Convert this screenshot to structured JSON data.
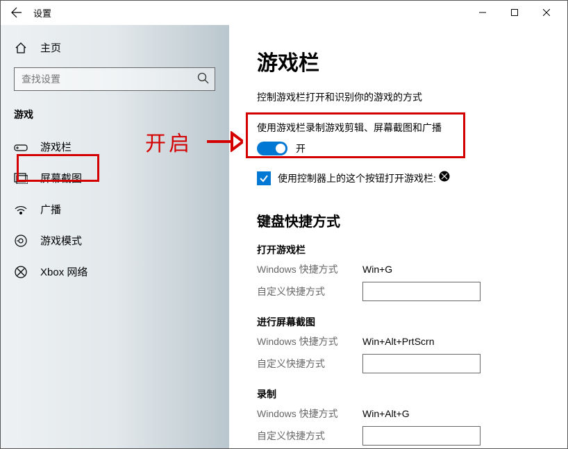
{
  "titlebar": {
    "title": "设置"
  },
  "sidebar": {
    "home_label": "主页",
    "search_placeholder": "查找设置",
    "section_header": "游戏",
    "items": [
      {
        "label": "游戏栏"
      },
      {
        "label": "屏幕截图"
      },
      {
        "label": "广播"
      },
      {
        "label": "游戏模式"
      },
      {
        "label": "Xbox 网络"
      }
    ]
  },
  "annotation": {
    "text": "开启"
  },
  "main": {
    "page_title": "游戏栏",
    "subtitle": "控制游戏栏打开和识别你的游戏的方式",
    "record_label": "使用游戏栏录制游戏剪辑、屏幕截图和广播",
    "toggle_on_text": "开",
    "checkbox_label": "使用控制器上的这个按钮打开游戏栏:",
    "shortcuts_title": "键盘快捷方式",
    "win_shortcut_label": "Windows 快捷方式",
    "custom_shortcut_label": "自定义快捷方式",
    "groups": [
      {
        "name": "打开游戏栏",
        "win_key": "Win+G",
        "custom": ""
      },
      {
        "name": "进行屏幕截图",
        "win_key": "Win+Alt+PrtScrn",
        "custom": ""
      },
      {
        "name": "录制",
        "win_key": "Win+Alt+G",
        "custom": ""
      }
    ]
  }
}
